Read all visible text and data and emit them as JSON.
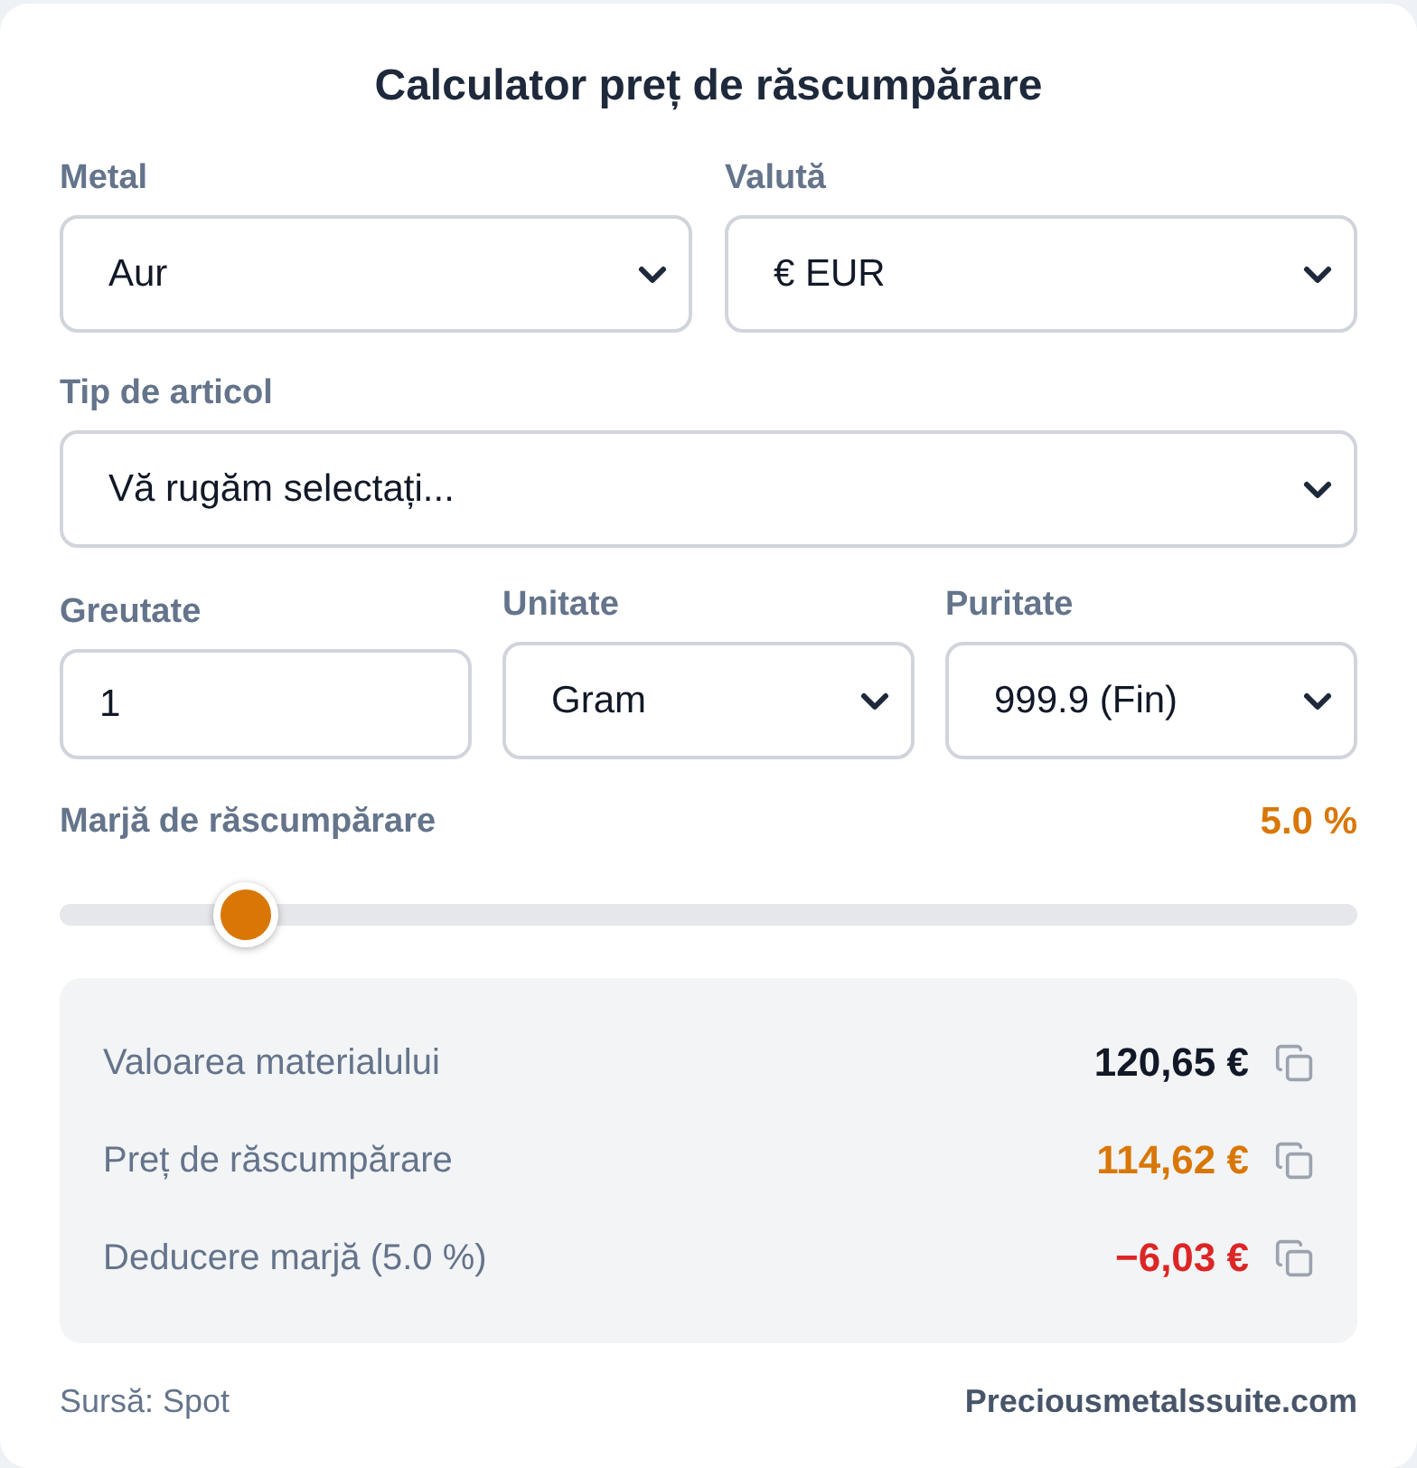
{
  "title": "Calculator preț de răscumpărare",
  "field_rows": [
    [
      {
        "kind": "select",
        "label": "Metal",
        "value": "Aur"
      },
      {
        "kind": "select",
        "label": "Valută",
        "value": "€ EUR"
      }
    ],
    [
      {
        "kind": "select",
        "label": "Tip de articol",
        "value": "Vă rugăm selectați..."
      }
    ],
    [
      {
        "kind": "input",
        "label": "Greutate",
        "value": "1"
      },
      {
        "kind": "select",
        "label": "Unitate",
        "value": "Gram"
      },
      {
        "kind": "select",
        "label": "Puritate",
        "value": "999.9 (Fin)"
      }
    ]
  ],
  "margin": {
    "label": "Marjă de răscumpărare",
    "reading": "5.0 %",
    "level": 0.143
  },
  "results": [
    {
      "label": "Valoarea materialului",
      "value": "120,65 €",
      "color": "#111827"
    },
    {
      "label": "Preț de răscumpărare",
      "value": "114,62 €",
      "color": "#d97706"
    },
    {
      "label": "Deducere marjă (5.0 %)",
      "value": "−6,03 €",
      "color": "#dc2626"
    }
  ],
  "footer": {
    "source": "Sursă: Spot",
    "brand": "Preciousmetalssuite.com"
  }
}
